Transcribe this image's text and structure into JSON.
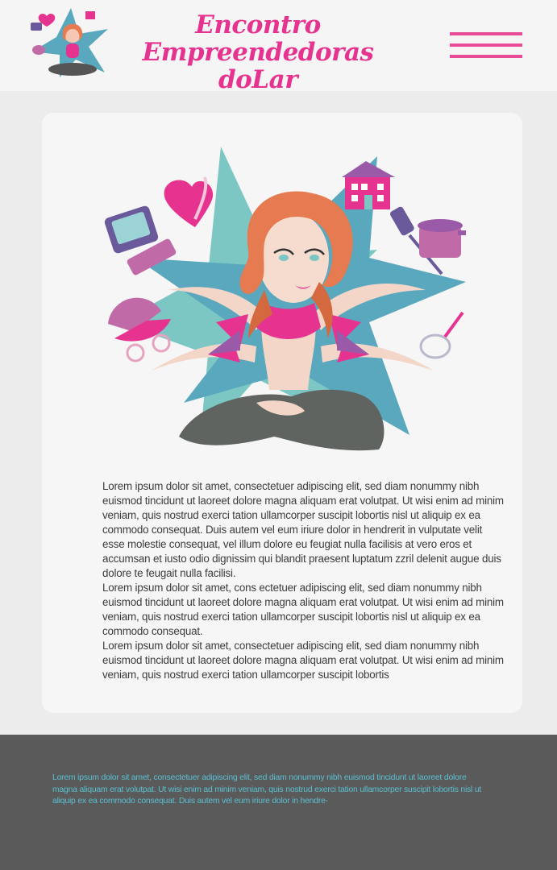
{
  "header": {
    "brand_line1": "Encontro Empreendedoras",
    "brand_line2": "doLar",
    "menu_icon": "hamburger-icon"
  },
  "colors": {
    "accent_pink": "#e6338f",
    "menu_pink": "#e94b97",
    "footer_bg": "#5a5a5a",
    "footer_text": "#5bbfd2",
    "star_teal": "#5aa8bd"
  },
  "illustration": {
    "icons": [
      "heart-icon",
      "house-icon",
      "laptop-icon",
      "cooking-pot-icon",
      "spatula-icon",
      "baby-stroller-icon",
      "whisk-icon",
      "star-icon"
    ]
  },
  "article": {
    "paragraph_1": "Lorem ipsum dolor sit amet, consectetuer adipiscing elit, sed diam nonummy nibh euismod tincidunt ut laoreet dolore magna aliquam erat volutpat. Ut wisi enim ad minim veniam, quis nostrud exerci tation ullamcorper suscipit lobortis nisl ut aliquip ex ea commodo consequat. Duis autem vel eum iriure dolor in hendrerit in vulputate velit esse molestie consequat, vel illum dolore eu feugiat nulla facilisis at vero eros et accumsan et iusto odio dignissim qui blandit praesent luptatum zzril delenit augue duis dolore te feugait nulla facilisi.",
    "paragraph_2": "Lorem ipsum dolor sit amet, cons ectetuer adipiscing elit, sed diam nonummy nibh euismod tincidunt ut laoreet dolore magna aliquam erat volutpat. Ut wisi enim ad minim veniam, quis nostrud exerci tation ullamcorper suscipit lobortis nisl ut aliquip ex ea commodo consequat.",
    "paragraph_3": "Lorem ipsum dolor sit amet, consectetuer adipiscing elit, sed diam nonummy nibh euismod tincidunt ut laoreet dolore magna aliquam erat volutpat. Ut wisi enim ad minim veniam, quis nostrud exerci tation ullamcorper suscipit lobortis"
  },
  "footer": {
    "text": "Lorem ipsum dolor sit amet, consectetuer adipiscing elit, sed diam nonummy nibh euismod tincidunt ut laoreet dolore magna aliquam erat volutpat. Ut wisi enim ad minim veniam, quis nostrud exerci tation ullamcorper suscipit lobortis nisl ut aliquip ex ea commodo consequat. Duis autem vel eum iriure dolor in hendre-"
  }
}
